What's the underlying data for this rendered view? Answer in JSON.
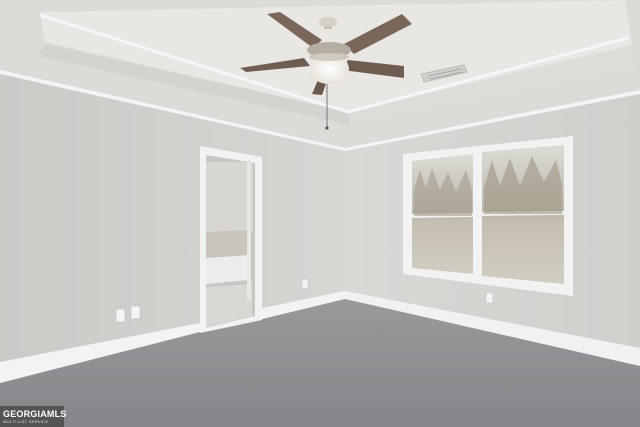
{
  "photo": {
    "subject": "empty bedroom",
    "colors": {
      "wall": "#d2d2cf",
      "ceiling": "#e9e8e6",
      "trim": "#f4f4f2",
      "carpet": "#8f8f92",
      "window_glass": "#c9c6bd"
    },
    "icons": [
      "ceiling-fan-icon",
      "hvac-vent-icon",
      "electrical-outlet-icon"
    ]
  },
  "watermark": {
    "brand": "GEORGIAMLS",
    "tagline": "MULTI-LIST SERVICE"
  }
}
